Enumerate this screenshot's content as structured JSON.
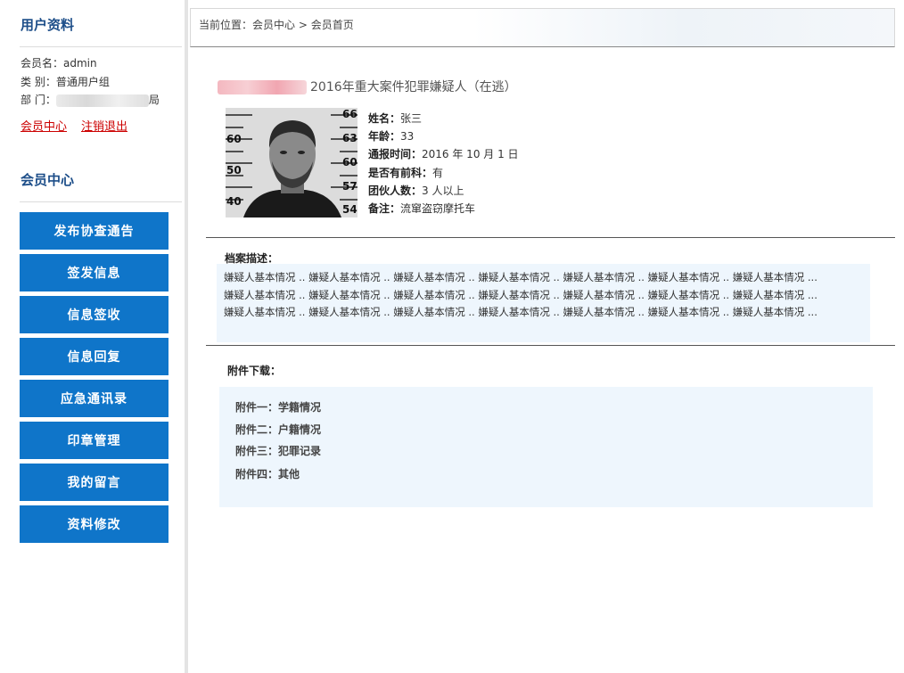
{
  "sidebar": {
    "profile_title": "用户资料",
    "member_line": "会员名：admin",
    "category_line": "类  别：普通用户组",
    "dept_label": "部  门：",
    "dept_suffix": "局",
    "links": {
      "member_center": "会员中心",
      "logout": "注销退出"
    },
    "center_title": "会员中心",
    "menu": [
      "发布协查通告",
      "签发信息",
      "信息签收",
      "信息回复",
      "应急通讯录",
      "印章管理",
      "我的留言",
      "资料修改"
    ]
  },
  "breadcrumb": {
    "prefix": "当前位置：",
    "items": [
      "会员中心",
      "会员首页"
    ],
    "separator": " > "
  },
  "case": {
    "title": "2016年重大案件犯罪嫌疑人（在逃）",
    "photo_marks": [
      "66",
      "60",
      "63",
      "60",
      "50",
      "57",
      "40",
      "54"
    ],
    "details": [
      {
        "label": "姓名：",
        "value": "张三"
      },
      {
        "label": "年龄：",
        "value": "33"
      },
      {
        "label": "通报时间：",
        "value": "2016 年 10 月 1 日"
      },
      {
        "label": "是否有前科：",
        "value": "有"
      },
      {
        "label": "团伙人数：",
        "value": "3 人以上"
      },
      {
        "label": "备注：",
        "value": "流窜盗窃摩托车"
      }
    ]
  },
  "description": {
    "label": "档案描述：",
    "lines": [
      "嫌疑人基本情况 .. 嫌疑人基本情况 .. 嫌疑人基本情况 .. 嫌疑人基本情况 .. 嫌疑人基本情况 .. 嫌疑人基本情况 .. 嫌疑人基本情况 ...",
      "嫌疑人基本情况 .. 嫌疑人基本情况 .. 嫌疑人基本情况 .. 嫌疑人基本情况 .. 嫌疑人基本情况 .. 嫌疑人基本情况 .. 嫌疑人基本情况 ...",
      "嫌疑人基本情况 .. 嫌疑人基本情况 .. 嫌疑人基本情况 .. 嫌疑人基本情况 .. 嫌疑人基本情况 .. 嫌疑人基本情况 .. 嫌疑人基本情况 ..."
    ]
  },
  "attachments": {
    "label": "附件下载：",
    "items": [
      "附件一：学籍情况",
      "附件二：户籍情况",
      "附件三：犯罪记录",
      "附件四：其他"
    ]
  },
  "colors": {
    "menu_button": "#0f75c9",
    "title_blue": "#1d4e89",
    "link_red": "#cc0000",
    "panel_bg": "#eef6fd"
  }
}
